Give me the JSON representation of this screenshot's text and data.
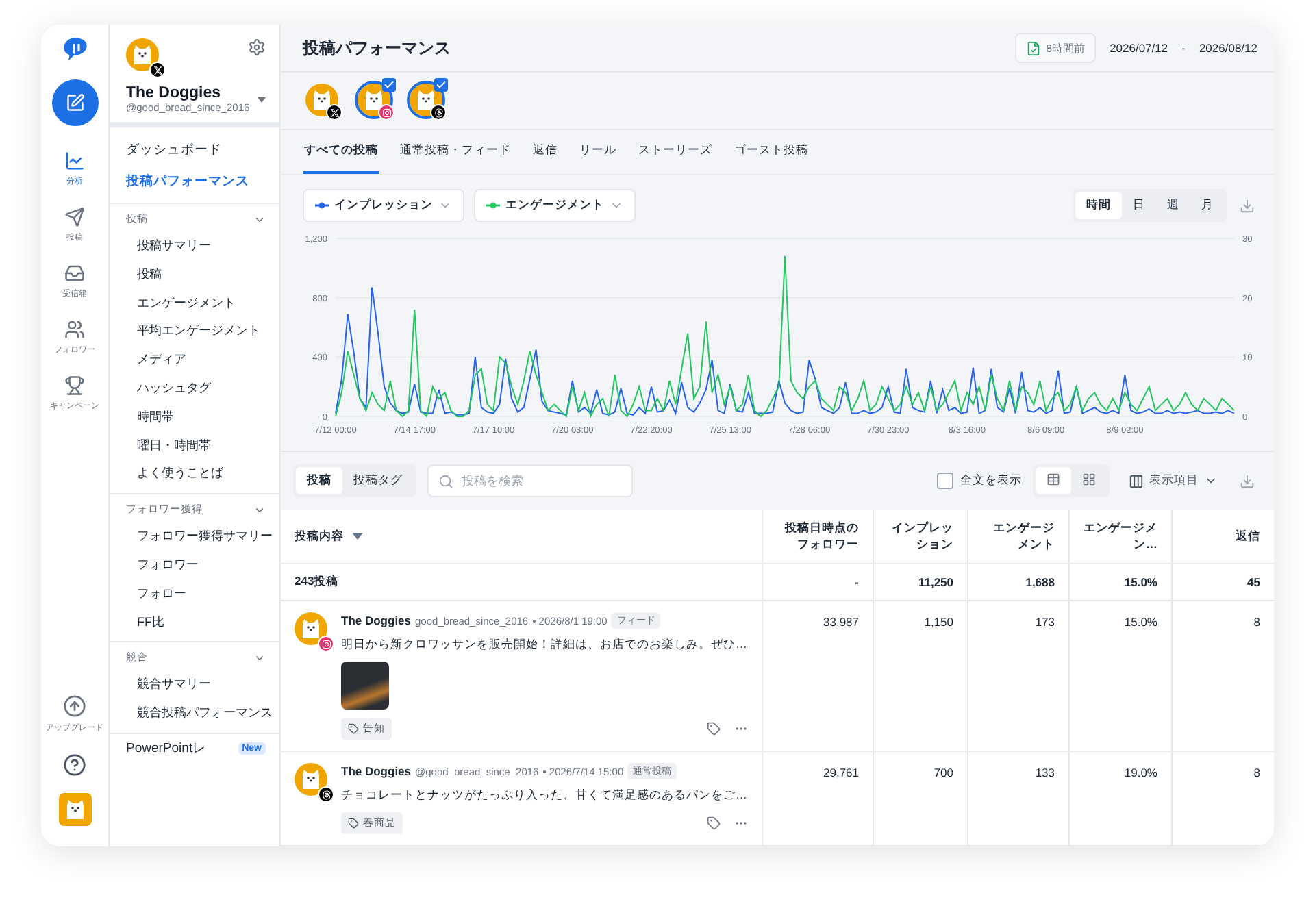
{
  "rail": {
    "items": [
      {
        "label": "分析",
        "kind": "chart",
        "selected": true
      },
      {
        "label": "投稿",
        "kind": "send",
        "selected": false
      },
      {
        "label": "受信箱",
        "kind": "inbox",
        "selected": false
      },
      {
        "label": "フォロワー",
        "kind": "users",
        "selected": false
      },
      {
        "label": "キャンペーン",
        "kind": "trophy",
        "selected": false
      }
    ],
    "upgrade": "アップグレード"
  },
  "sidebar": {
    "account_name": "The Doggies",
    "account_handle": "@good_bread_since_2016",
    "top_items": [
      {
        "label": "ダッシュボード",
        "selected": false
      },
      {
        "label": "投稿パフォーマンス",
        "selected": true
      }
    ],
    "sections": [
      {
        "title": "投稿",
        "expanded": true,
        "items": [
          "投稿サマリー",
          "投稿",
          "エンゲージメント",
          "平均エンゲージメント",
          "メディア",
          "ハッシュタグ",
          "時間帯",
          "曜日・時間帯",
          "よく使うことば"
        ]
      },
      {
        "title": "フォロワー獲得",
        "expanded": true,
        "items": [
          "フォロワー獲得サマリー",
          "フォロワー",
          "フォロー",
          "FF比"
        ]
      },
      {
        "title": "競合",
        "expanded": true,
        "items": [
          "競合サマリー",
          "競合投稿パフォーマンス"
        ]
      }
    ],
    "extra_item": {
      "label": "PowerPointレ",
      "badge": "New"
    }
  },
  "header": {
    "title": "投稿パフォーマンス",
    "report_time": "8時間前",
    "date_from": "2026/07/12",
    "date_sep": "-",
    "date_to": "2026/08/12"
  },
  "accounts": [
    {
      "kind": "x",
      "selected": false
    },
    {
      "kind": "instagram",
      "selected": true
    },
    {
      "kind": "threads",
      "selected": true
    }
  ],
  "tabs": [
    {
      "label": "すべての投稿",
      "selected": true
    },
    {
      "label": "通常投稿・フィード",
      "selected": false
    },
    {
      "label": "返信",
      "selected": false
    },
    {
      "label": "リール",
      "selected": false
    },
    {
      "label": "ストーリーズ",
      "selected": false
    },
    {
      "label": "ゴースト投稿",
      "selected": false
    }
  ],
  "granularity": [
    {
      "label": "時間",
      "selected": true
    },
    {
      "label": "日",
      "selected": false
    },
    {
      "label": "週",
      "selected": false
    },
    {
      "label": "月",
      "selected": false
    }
  ],
  "chart": {
    "chart_data": {
      "type": "line",
      "ylim": [
        0,
        1200
      ],
      "y2lim": [
        0,
        30
      ],
      "categories": [
        "7/12 00:00",
        null,
        null,
        null,
        null,
        null,
        null,
        null,
        null,
        null,
        null,
        null,
        null,
        "7/14 17:00",
        null,
        null,
        null,
        null,
        null,
        null,
        null,
        null,
        null,
        null,
        null,
        null,
        "7/17 10:00",
        null,
        null,
        null,
        null,
        null,
        null,
        null,
        null,
        null,
        null,
        null,
        null,
        "7/20 03:00",
        null,
        null,
        null,
        null,
        null,
        null,
        null,
        null,
        null,
        null,
        null,
        null,
        "7/22 20:00",
        null,
        null,
        null,
        null,
        null,
        null,
        null,
        null,
        null,
        null,
        null,
        null,
        "7/25 13:00",
        null,
        null,
        null,
        null,
        null,
        null,
        null,
        null,
        null,
        null,
        null,
        null,
        "7/28 06:00",
        null,
        null,
        null,
        null,
        null,
        null,
        null,
        null,
        null,
        null,
        null,
        null,
        "7/30 23:00",
        null,
        null,
        null,
        null,
        null,
        null,
        null,
        null,
        null,
        null,
        null,
        null,
        "8/3 16:00",
        null,
        null,
        null,
        null,
        null,
        null,
        null,
        null,
        null,
        null,
        null,
        null,
        "8/6 09:00",
        null,
        null,
        null,
        null,
        null,
        null,
        null,
        null,
        null,
        null,
        null,
        null,
        "8/9 02:00",
        null,
        null,
        null,
        null,
        null,
        null,
        null,
        null,
        null,
        null,
        null,
        null,
        null,
        null,
        null,
        null,
        null,
        null
      ],
      "yticks": [
        0,
        400,
        800,
        {
          "value": 1200,
          "label": "1,200"
        }
      ],
      "y2ticks": [
        0,
        10,
        20,
        30
      ],
      "series": [
        {
          "name": "インプレッション",
          "color": "#2563eb",
          "values": [
            20,
            250,
            690,
            430,
            120,
            60,
            870,
            560,
            200,
            90,
            40,
            20,
            30,
            220,
            30,
            20,
            20,
            180,
            20,
            30,
            10,
            10,
            20,
            400,
            60,
            30,
            20,
            80,
            390,
            120,
            30,
            60,
            250,
            450,
            100,
            40,
            30,
            20,
            10,
            240,
            30,
            60,
            20,
            180,
            20,
            10,
            30,
            190,
            20,
            10,
            60,
            20,
            200,
            30,
            40,
            110,
            20,
            230,
            60,
            30,
            90,
            180,
            380,
            40,
            20,
            220,
            40,
            30,
            160,
            20,
            20,
            20,
            30,
            240,
            90,
            40,
            20,
            30,
            380,
            250,
            60,
            40,
            20,
            60,
            230,
            20,
            20,
            40,
            20,
            30,
            60,
            200,
            30,
            20,
            320,
            60,
            40,
            30,
            240,
            20,
            180,
            40,
            60,
            20,
            30,
            330,
            20,
            40,
            320,
            60,
            30,
            190,
            20,
            300,
            40,
            30,
            60,
            20,
            40,
            310,
            20,
            30,
            200,
            20,
            40,
            60,
            30,
            20,
            40,
            20,
            280,
            40,
            20,
            30,
            50,
            20,
            20,
            40,
            20,
            30,
            20,
            30,
            40,
            20,
            20,
            30,
            20,
            40,
            20
          ]
        },
        {
          "name": "エンゲージメント",
          "color": "#22c55e",
          "axis": "y2",
          "values": [
            0,
            4,
            11,
            7,
            3,
            1,
            4,
            2,
            1,
            6,
            1,
            0,
            1,
            18,
            1,
            0,
            5,
            3,
            4,
            1,
            0,
            0,
            1,
            7,
            8,
            2,
            1,
            10,
            9,
            5,
            2,
            6,
            11,
            7,
            4,
            1,
            2,
            1,
            0,
            5,
            1,
            4,
            0,
            2,
            3,
            0,
            7,
            1,
            0,
            2,
            5,
            1,
            1,
            3,
            1,
            6,
            2,
            8,
            14,
            3,
            5,
            16,
            4,
            7,
            2,
            5,
            1,
            2,
            7,
            1,
            0,
            1,
            3,
            5,
            27,
            6,
            4,
            3,
            5,
            6,
            3,
            2,
            1,
            5,
            4,
            1,
            3,
            6,
            1,
            2,
            5,
            3,
            1,
            2,
            5,
            2,
            4,
            1,
            5,
            1,
            2,
            4,
            6,
            1,
            4,
            2,
            5,
            1,
            7,
            3,
            1,
            6,
            1,
            5,
            4,
            2,
            6,
            1,
            3,
            4,
            1,
            2,
            5,
            1,
            3,
            4,
            2,
            1,
            3,
            1,
            4,
            2,
            1,
            3,
            5,
            1,
            2,
            3,
            1,
            2,
            4,
            2,
            1,
            3,
            2,
            1,
            3,
            2,
            1
          ]
        }
      ]
    }
  },
  "table_toolbar": {
    "modes": [
      {
        "label": "投稿",
        "selected": true
      },
      {
        "label": "投稿タグ",
        "selected": false
      }
    ],
    "search_placeholder": "投稿を検索",
    "full_text": {
      "label": "全文を表示",
      "checked": false
    },
    "views": [
      {
        "kind": "table",
        "selected": true
      },
      {
        "kind": "grid",
        "selected": false
      }
    ],
    "columns_label": "表示項目"
  },
  "table": {
    "columns": [
      "投稿内容",
      "投稿日時点のフォロワー",
      "インプレッション",
      "エンゲージメント",
      "エンゲージメン…",
      "返信"
    ],
    "summary": [
      "243投稿",
      "-",
      "11,250",
      "1,688",
      "15.0%",
      "45"
    ],
    "rows": [
      {
        "name": "The Doggies",
        "handle": "good_bread_since_2016",
        "date": "• 2026/8/1 19:00",
        "type": "フィード",
        "kind": "instagram",
        "text": "明日から新クロワッサンを販売開始！詳細は、お店でのお楽しみ。ぜひ…",
        "photo": true,
        "tag": "告知",
        "values": [
          "33,987",
          "1,150",
          "173",
          "15.0%",
          "8"
        ]
      },
      {
        "name": "The Doggies",
        "handle": "@good_bread_since_2016",
        "date": "• 2026/7/14 15:00",
        "type": "通常投稿",
        "kind": "threads",
        "text": "チョコレートとナッツがたっぷり入った、甘くて満足感のあるパンをご…",
        "photo": false,
        "tag": "春商品",
        "values": [
          "29,761",
          "700",
          "133",
          "19.0%",
          "8"
        ]
      }
    ]
  }
}
